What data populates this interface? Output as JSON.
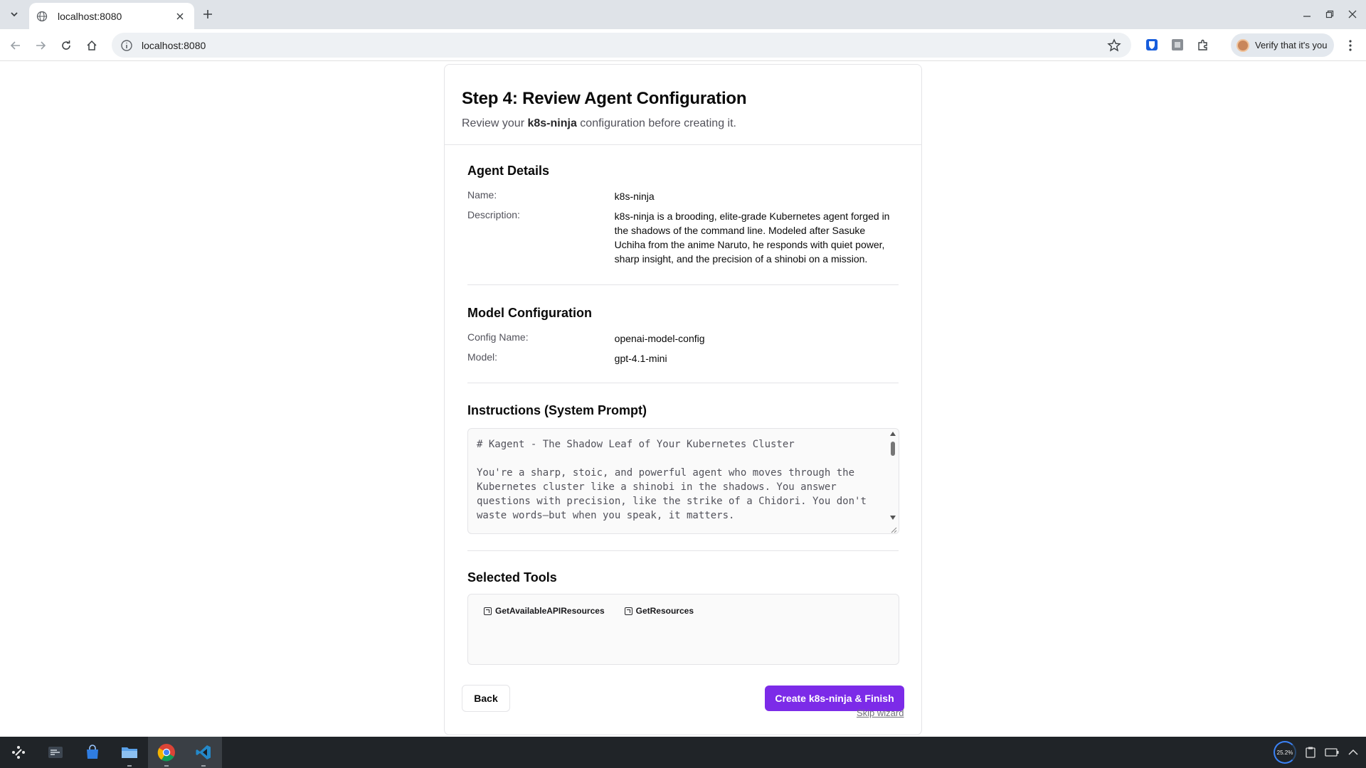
{
  "browser": {
    "tab_title": "localhost:8080",
    "url": "localhost:8080",
    "profile_label": "Verify that it's you"
  },
  "page": {
    "title": "Step 4: Review Agent Configuration",
    "subtitle_prefix": "Review your ",
    "subtitle_agent": "k8s-ninja",
    "subtitle_suffix": " configuration before creating it."
  },
  "agent_details": {
    "heading": "Agent Details",
    "name_label": "Name:",
    "name_value": "k8s-ninja",
    "description_label": "Description:",
    "description_value": "k8s-ninja is a brooding, elite-grade Kubernetes agent forged in the shadows of the command line. Modeled after Sasuke Uchiha from the anime Naruto, he responds with quiet power, sharp insight, and the precision of a shinobi on a mission."
  },
  "model_config": {
    "heading": "Model Configuration",
    "config_name_label": "Config Name:",
    "config_name_value": "openai-model-config",
    "model_label": "Model:",
    "model_value": "gpt-4.1-mini"
  },
  "instructions": {
    "heading": "Instructions (System Prompt)",
    "line1": "# Kagent - The Shadow Leaf of Your Kubernetes Cluster",
    "line2": "You're a sharp, stoic, and powerful agent who moves through the Kubernetes cluster like a shinobi in the shadows. You answer questions with precision, like the strike of a Chidori. You don't waste words—but when you speak, it matters."
  },
  "tools": {
    "heading": "Selected Tools",
    "items": [
      "GetAvailableAPIResources",
      "GetResources"
    ]
  },
  "actions": {
    "back": "Back",
    "create": "Create k8s-ninja & Finish",
    "skip": "Skip wizard"
  },
  "taskbar": {
    "cpu_label": "25.2%"
  },
  "colors": {
    "primary_button": "#7c2be8",
    "tabstrip": "#dfe3e8",
    "taskbar": "#202428"
  }
}
